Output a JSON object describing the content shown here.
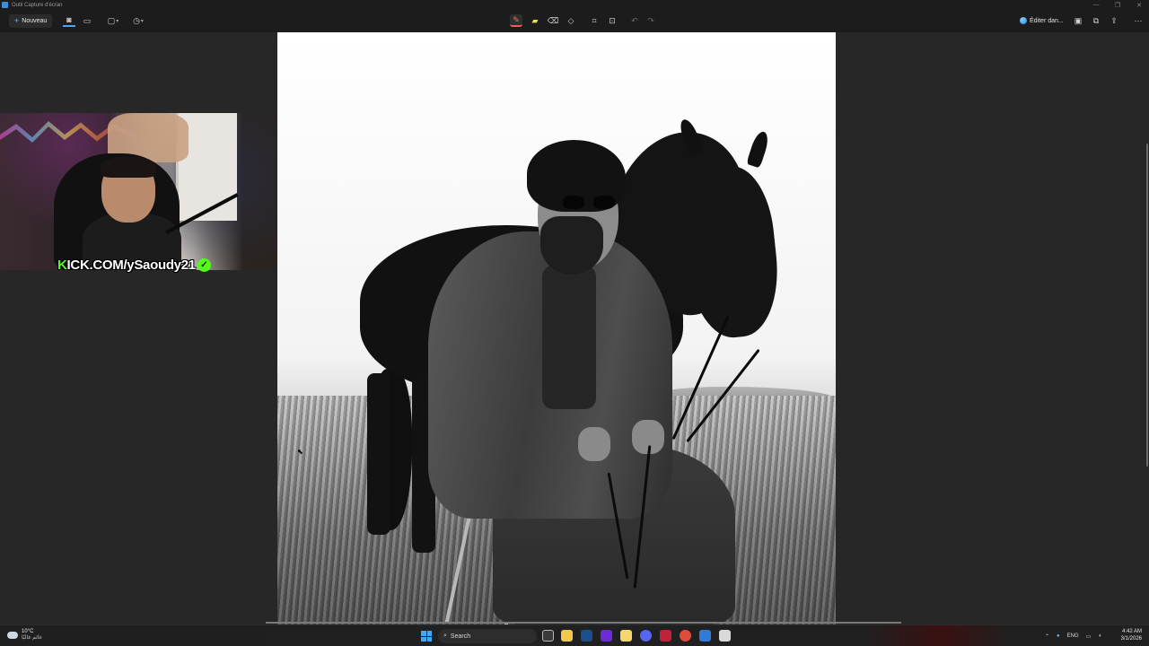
{
  "window": {
    "title": "Outil Capture d'écran",
    "controls": [
      "—",
      "❐",
      "✕"
    ]
  },
  "toolbar": {
    "new_label": "Nouveau",
    "new_icon": "plus-icon",
    "edit_in_label": "Éditer dan..."
  },
  "overlay": {
    "kick_prefix": "K",
    "kick_text": "ICK.COM/ySaoudy21",
    "verified_glyph": "✓"
  },
  "taskbar": {
    "weather_temp": "10°C",
    "weather_desc": "غائم غالبًا",
    "search_placeholder": "Search",
    "language": "ENG",
    "time": "4:42 AM",
    "date": "3/1/2026"
  },
  "colors": {
    "accent": "#4aa3ff",
    "kick_green": "#53fc18",
    "pen_red": "#ff5a5a",
    "background": "#272727"
  }
}
